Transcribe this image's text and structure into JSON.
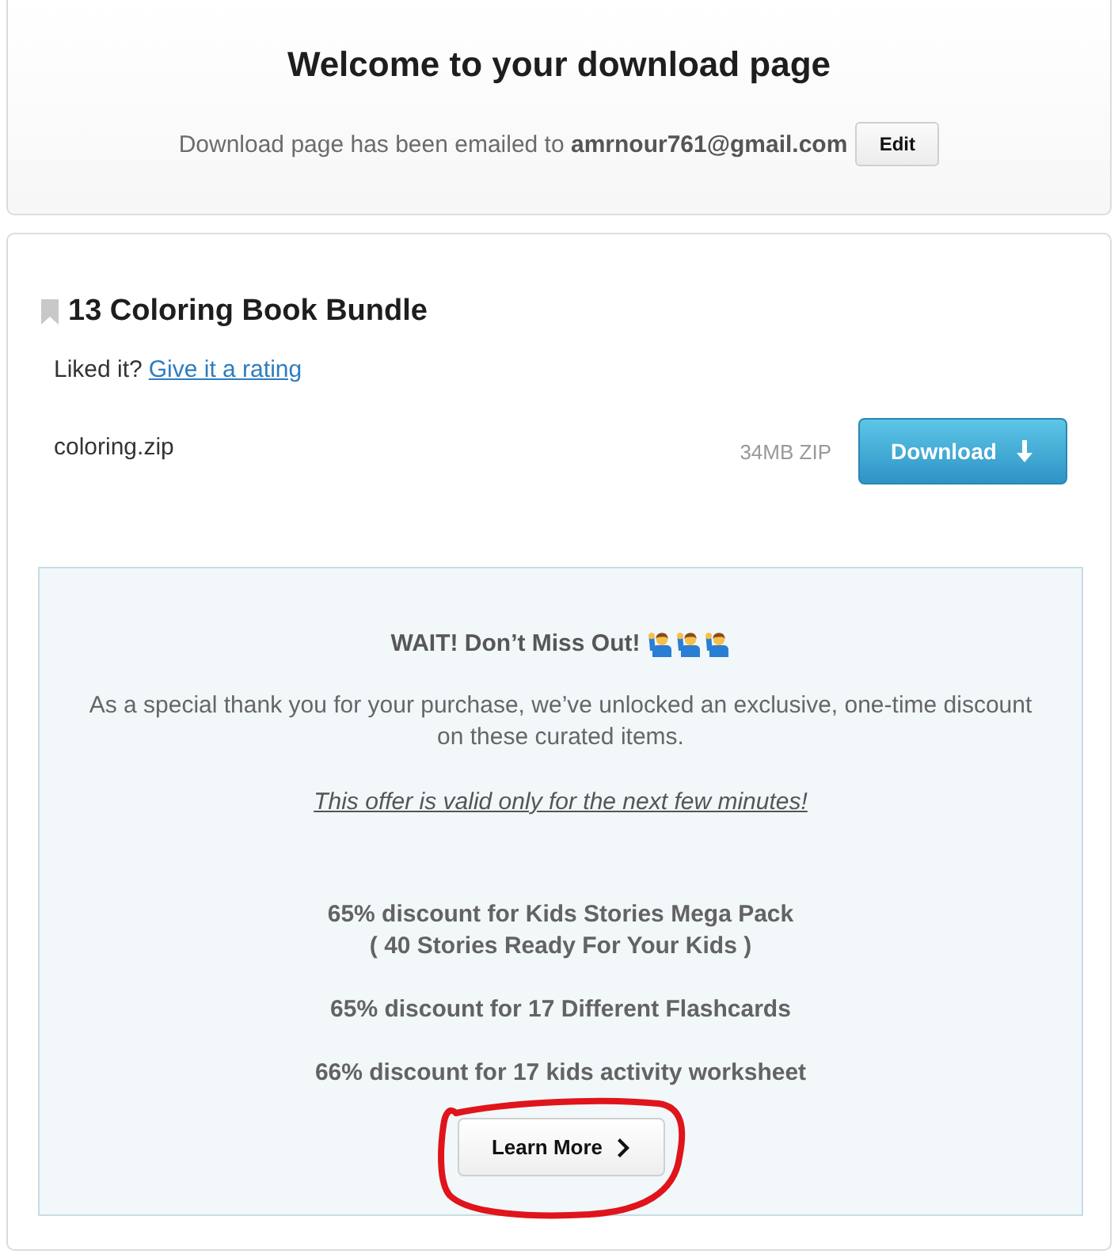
{
  "header": {
    "title": "Welcome to your download page",
    "email_notice": "Download page has been emailed to **amrnour761@gmail.com**",
    "edit_button": "Edit"
  },
  "product": {
    "title": "13 Coloring Book Bundle",
    "rating_prompt": "Liked it?",
    "rating_link": "Give it a rating",
    "files": [
      {
        "name": "coloring.zip",
        "size": "34MB ZIP",
        "download_button": "Download"
      }
    ]
  },
  "offer": {
    "heading": "WAIT! Don’t Miss Out!",
    "message": "As a special thank you for your purchase, we’ve unlocked an exclusive, one-time discount on these curated items.",
    "notice": "This offer is valid only for the next few minutes!",
    "discounts": [
      {
        "lines": [
          "65% discount for Kids Stories Mega Pack",
          "( 40 Stories Ready For Your Kids )"
        ]
      },
      {
        "lines": [
          "65% discount for 17 Different Flashcards"
        ]
      },
      {
        "lines": [
          "66% discount for 17 kids activity worksheet"
        ]
      }
    ],
    "learn_more_button": {
      "label": "Learn More",
      "circled": true
    }
  }
}
